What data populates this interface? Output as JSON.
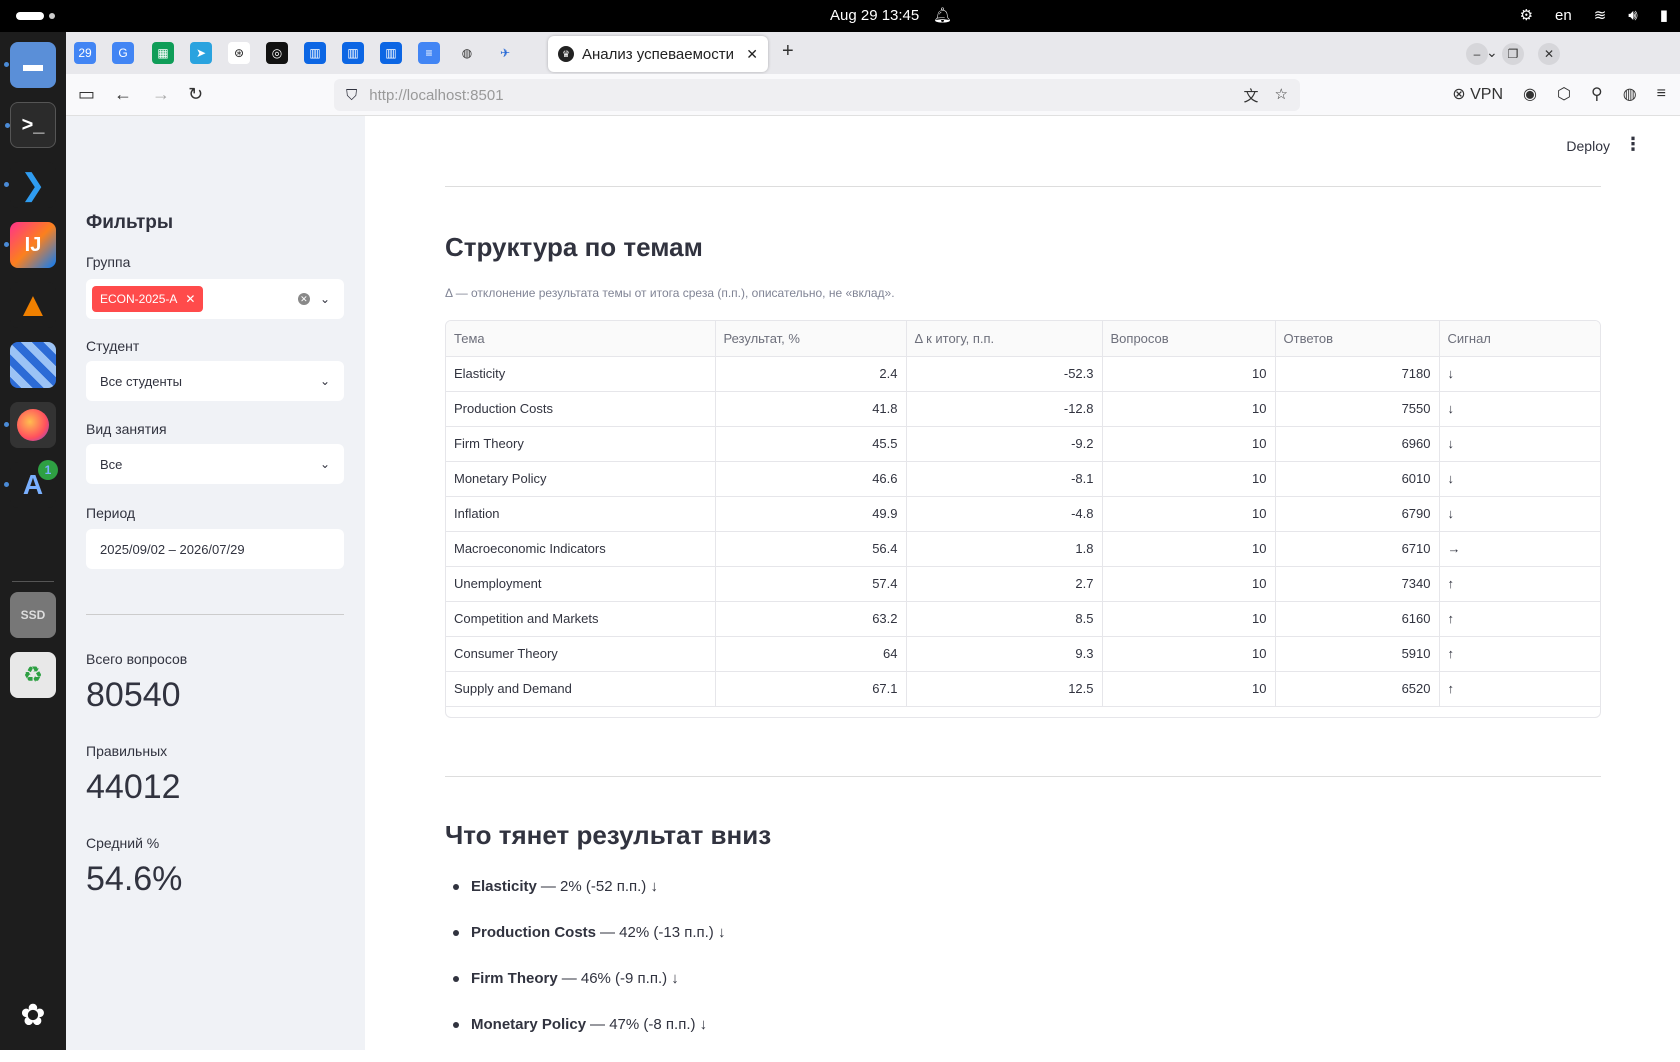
{
  "system": {
    "clock": "Aug 29  13:45",
    "language": "en"
  },
  "browser": {
    "active_tab_title": "Анализ успеваемости",
    "url_host": "http://localhost",
    "url_port": ":8501",
    "vpn_label": "VPN"
  },
  "sidebar": {
    "title": "Фильтры",
    "group_label": "Группа",
    "group_tag": "ECON-2025-A",
    "student_label": "Студент",
    "student_value": "Все студенты",
    "activity_label": "Вид занятия",
    "activity_value": "Все",
    "period_label": "Период",
    "period_value": "2025/09/02 – 2026/07/29",
    "metrics": [
      {
        "label": "Всего вопросов",
        "value": "80540"
      },
      {
        "label": "Правильных",
        "value": "44012"
      },
      {
        "label": "Средний %",
        "value": "54.6%"
      }
    ]
  },
  "main": {
    "deploy_label": "Deploy",
    "section1_title": "Структура по темам",
    "caption": "Δ — отклонение результата темы от итога среза (п.п.), описательно, не «вклад».",
    "columns": [
      "Тема",
      "Результат, %",
      "Δ к итогу, п.п.",
      "Вопросов",
      "Ответов",
      "Сигнал"
    ],
    "rows": [
      [
        "Elasticity",
        "2.4",
        "-52.3",
        "10",
        "7180",
        "↓"
      ],
      [
        "Production Costs",
        "41.8",
        "-12.8",
        "10",
        "7550",
        "↓"
      ],
      [
        "Firm Theory",
        "45.5",
        "-9.2",
        "10",
        "6960",
        "↓"
      ],
      [
        "Monetary Policy",
        "46.6",
        "-8.1",
        "10",
        "6010",
        "↓"
      ],
      [
        "Inflation",
        "49.9",
        "-4.8",
        "10",
        "6790",
        "↓"
      ],
      [
        "Macroeconomic Indicators",
        "56.4",
        "1.8",
        "10",
        "6710",
        "→"
      ],
      [
        "Unemployment",
        "57.4",
        "2.7",
        "10",
        "7340",
        "↑"
      ],
      [
        "Competition and Markets",
        "63.2",
        "8.5",
        "10",
        "6160",
        "↑"
      ],
      [
        "Consumer Theory",
        "64",
        "9.3",
        "10",
        "5910",
        "↑"
      ],
      [
        "Supply and Demand",
        "67.1",
        "12.5",
        "10",
        "6520",
        "↑"
      ]
    ],
    "section2_title": "Что тянет результат вниз",
    "drag_items": [
      {
        "topic": "Elasticity",
        "detail": "— 2% (-52 п.п.) ↓"
      },
      {
        "topic": "Production Costs",
        "detail": "— 42% (-13 п.п.) ↓"
      },
      {
        "topic": "Firm Theory",
        "detail": "— 46% (-9 п.п.) ↓"
      },
      {
        "topic": "Monetary Policy",
        "detail": "— 47% (-8 п.п.) ↓"
      }
    ]
  },
  "colors": {
    "accent": "#ff4b4b",
    "sidebar_bg": "#f0f2f6",
    "text": "#31333f"
  }
}
